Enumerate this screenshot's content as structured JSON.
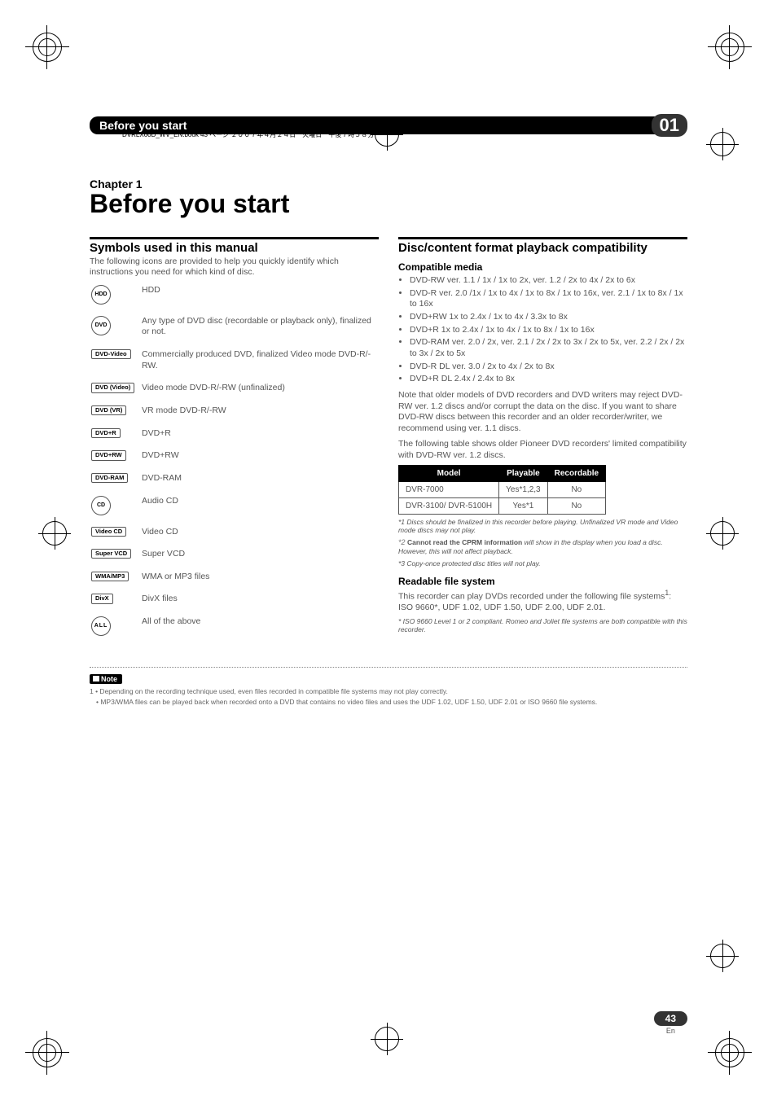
{
  "header_file_line": "DVRLX60D_WV_EN.book 43 ページ ２００７年４月２４日　火曜日　午後７時５８分",
  "section_bar": {
    "title": "Before you start",
    "number": "01"
  },
  "chapter": {
    "label": "Chapter 1",
    "title": "Before you start"
  },
  "left": {
    "h2": "Symbols used in this manual",
    "intro": "The following icons are provided to help you quickly identify which instructions you need for which kind of disc.",
    "symbols": [
      {
        "icon": "HDD",
        "round": true,
        "text": "HDD"
      },
      {
        "icon": "DVD",
        "round": true,
        "text": "Any type of DVD disc (recordable or playback only), finalized or not."
      },
      {
        "icon": "DVD-Video",
        "text": "Commercially produced DVD, finalized Video mode DVD-R/-RW."
      },
      {
        "icon": "DVD (Video)",
        "text": "Video mode DVD-R/-RW (unfinalized)"
      },
      {
        "icon": "DVD (VR)",
        "text": "VR mode DVD-R/-RW"
      },
      {
        "icon": "DVD+R",
        "text": "DVD+R"
      },
      {
        "icon": "DVD+RW",
        "text": "DVD+RW"
      },
      {
        "icon": "DVD-RAM",
        "text": "DVD-RAM"
      },
      {
        "icon": "CD",
        "round": true,
        "text": "Audio CD"
      },
      {
        "icon": "Video CD",
        "text": "Video CD"
      },
      {
        "icon": "Super VCD",
        "text": "Super VCD"
      },
      {
        "icon": "WMA/MP3",
        "text": "WMA or MP3 files"
      },
      {
        "icon": "DivX",
        "text": "DivX files"
      },
      {
        "icon": "ALL",
        "round": true,
        "text": "All of the above"
      }
    ]
  },
  "right": {
    "h2": "Disc/content format playback compatibility",
    "h3a": "Compatible media",
    "media": [
      "DVD-RW ver. 1.1 / 1x / 1x to 2x, ver. 1.2 / 2x to 4x / 2x to 6x",
      "DVD-R ver. 2.0 /1x / 1x to 4x / 1x to 8x / 1x to 16x, ver. 2.1 / 1x to 8x / 1x to 16x",
      "DVD+RW 1x to 2.4x / 1x to 4x / 3.3x to 8x",
      "DVD+R 1x to 2.4x / 1x to 4x / 1x to 8x / 1x to 16x",
      "DVD-RAM ver. 2.0 / 2x, ver. 2.1 / 2x / 2x to 3x / 2x to 5x, ver. 2.2 / 2x / 2x to 3x / 2x to 5x",
      "DVD-R DL ver. 3.0 / 2x to 4x / 2x to 8x",
      "DVD+R DL 2.4x / 2.4x to 8x"
    ],
    "para1": "Note that older models of DVD recorders and DVD writers may reject DVD-RW ver. 1.2 discs and/or corrupt the data on the disc. If you want to share DVD-RW discs between this recorder and an older recorder/writer, we recommend using ver. 1.1 discs.",
    "para2": "The following table shows older Pioneer DVD recorders' limited compatibility with DVD-RW ver. 1.2 discs.",
    "table": {
      "headers": [
        "Model",
        "Playable",
        "Recordable"
      ],
      "rows": [
        [
          "DVR-7000",
          "Yes*1,2,3",
          "No"
        ],
        [
          "DVR-3100/ DVR-5100H",
          "Yes*1",
          "No"
        ]
      ]
    },
    "footnotes": [
      "*1 Discs should be finalized in this recorder before playing. Unfinalized VR mode and Video mode discs may not play.",
      "*2 Cannot read the CPRM information will show in the display when you load a disc. However, this will not affect playback.",
      "*3 Copy-once protected disc titles will not play."
    ],
    "h3b": "Readable file system",
    "rfs_intro": "This recorder can play DVDs recorded under the following file systems",
    "rfs_sup": "1",
    "rfs_cont": ": ISO 9660*, UDF 1.02, UDF 1.50, UDF 2.00, UDF 2.01.",
    "rfs_foot": "* ISO 9660 Level 1 or 2 compliant. Romeo and Joliet file systems are both compatible with this recorder."
  },
  "note": {
    "label": "Note",
    "lines": [
      "1 • Depending on the recording technique used, even files recorded in compatible file systems may not play correctly.",
      "• MP3/WMA files can be played back when recorded onto a DVD that contains no video files and uses the UDF 1.02, UDF 1.50, UDF 2.01 or ISO 9660 file systems."
    ]
  },
  "page_number": "43",
  "page_lang": "En"
}
